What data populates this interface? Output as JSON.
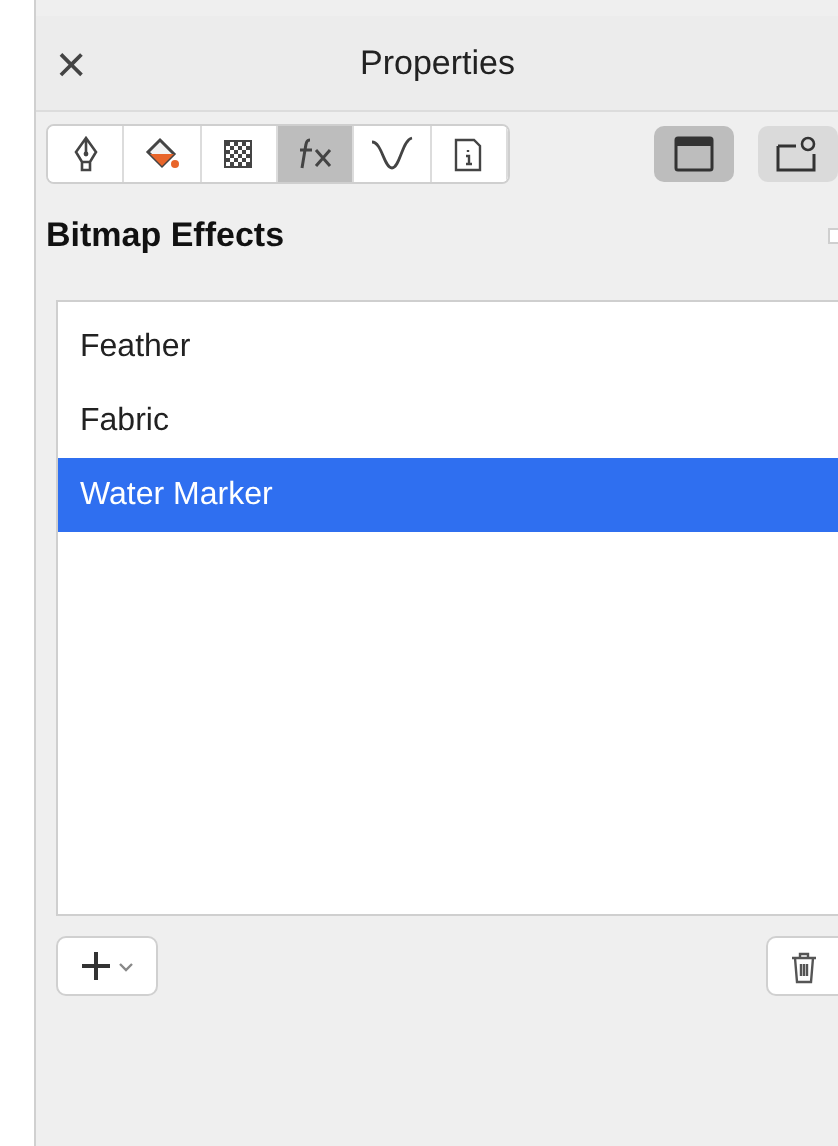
{
  "panel": {
    "title": "Properties",
    "close": "×"
  },
  "tabs": [
    {
      "kind": "pen",
      "selected": false
    },
    {
      "kind": "fill",
      "selected": false
    },
    {
      "kind": "transparency",
      "selected": false
    },
    {
      "kind": "effects",
      "selected": true
    },
    {
      "kind": "curve",
      "selected": false
    },
    {
      "kind": "info",
      "selected": false
    }
  ],
  "view_buttons": [
    {
      "kind": "frame",
      "selected": true
    },
    {
      "kind": "preview",
      "selected": false
    }
  ],
  "section": {
    "title": "Bitmap Effects",
    "checked": false
  },
  "effects": [
    {
      "label": "Feather",
      "selected": false
    },
    {
      "label": "Fabric",
      "selected": false
    },
    {
      "label": "Water Marker",
      "selected": true
    }
  ]
}
